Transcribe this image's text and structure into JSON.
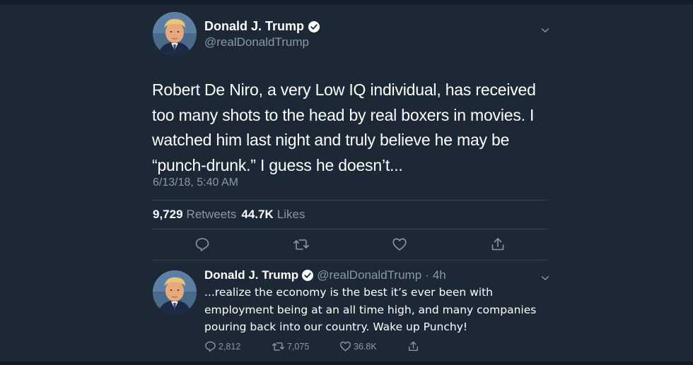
{
  "main_tweet": {
    "name": "Donald J. Trump",
    "handle": "@realDonaldTrump",
    "text": "Robert De Niro, a very Low IQ individual, has received too many shots to the head by real boxers in movies. I watched him last night and truly believe he may be “punch-drunk.” I guess he doesn’t...",
    "timestamp": "6/13/18, 5:40 AM",
    "retweets_count": "9,729",
    "retweets_label": "Retweets",
    "likes_count": "44.7K",
    "likes_label": "Likes",
    "actions": [
      "reply-icon",
      "retweet-icon",
      "like-icon",
      "share-icon"
    ]
  },
  "reply_tweet": {
    "name": "Donald J. Trump",
    "handle": "@realDonaldTrump",
    "separator": "·",
    "time": "4h",
    "text": "...realize the economy is the best it’s ever been with employment being at an all time high, and many companies pouring back into our country. Wake up Punchy!",
    "reply_count": "2,812",
    "retweet_count": "7,075",
    "like_count": "36.8K"
  },
  "colors": {
    "background": "#1c2836",
    "primary_text": "#ffffff",
    "secondary_text": "#8899a6",
    "divider": "#38444d"
  }
}
